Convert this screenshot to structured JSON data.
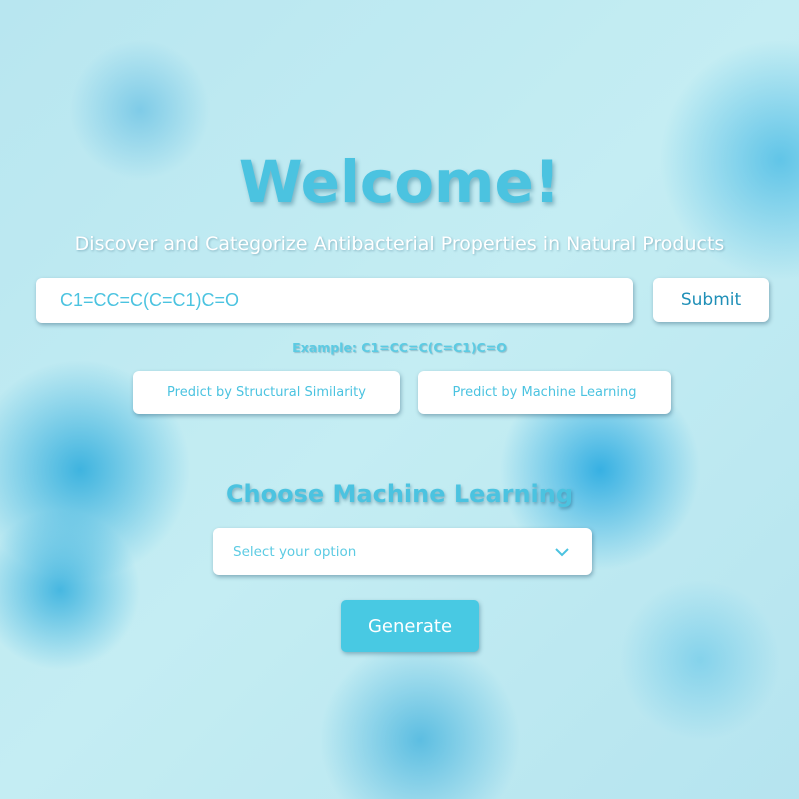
{
  "header": {
    "title": "Welcome!",
    "subtitle": "Discover and Categorize Antibacterial Properties in Natural Products"
  },
  "search": {
    "value": "C1=CC=C(C=C1)C=O",
    "submit_label": "Submit",
    "example": "Example: C1=CC=C(C=C1)C=O"
  },
  "predict_buttons": [
    {
      "label": "Predict by Structural Similarity"
    },
    {
      "label": "Predict by Machine Learning"
    }
  ],
  "ml": {
    "heading": "Choose Machine Learning",
    "select_placeholder": "Select your option",
    "generate_label": "Generate"
  },
  "colors": {
    "accent": "#4bc3e0",
    "button": "#48c9e3"
  }
}
